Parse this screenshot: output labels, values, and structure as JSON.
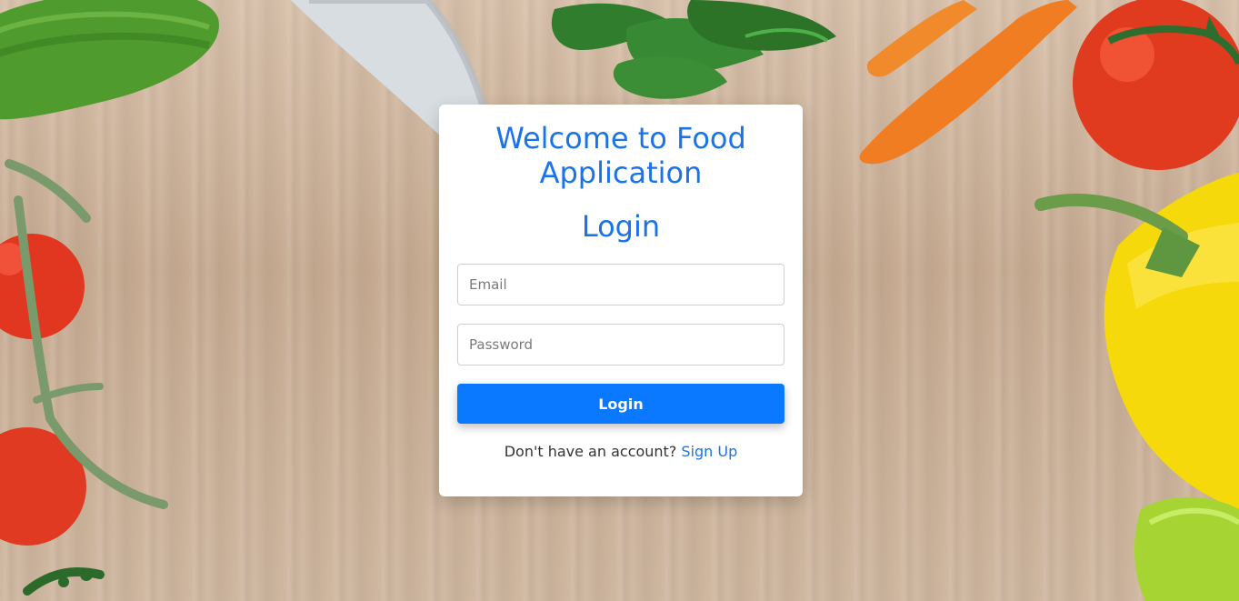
{
  "login": {
    "heading": "Welcome to Food Application",
    "subheading": "Login",
    "email_placeholder": "Email",
    "password_placeholder": "Password",
    "button_label": "Login",
    "footer_text": "Don't have an account?",
    "signup_label": "Sign Up"
  },
  "colors": {
    "accent": "#1a73e8",
    "button": "#0a78ff",
    "card": "#ffffff"
  },
  "background": {
    "items": [
      "cucumber",
      "knife",
      "parsley",
      "carrots",
      "tomato",
      "tomatoes-on-vine",
      "yellow-pepper",
      "green-pepper",
      "herbs"
    ]
  }
}
